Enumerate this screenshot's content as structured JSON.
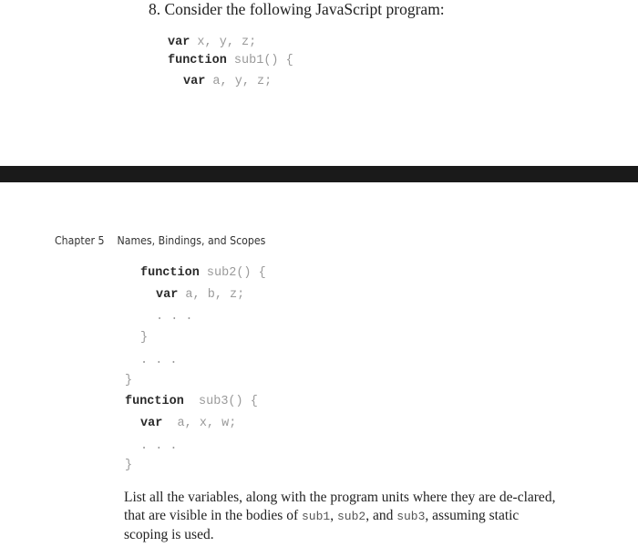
{
  "exercise": {
    "title": "8. Consider the following JavaScript program:"
  },
  "code_top": [
    {
      "kw": "var",
      "rest": " x, y, z;"
    },
    {
      "kw": "function",
      "rest": " sub1() {"
    },
    {
      "kw": "var",
      "rest": " a, y, z;"
    }
  ],
  "separator_color": "#1a1a1a",
  "running_head": {
    "chapter": "Chapter 5",
    "title": "Names, Bindings, and Scopes"
  },
  "code_bottom": [
    {
      "kw": "function",
      "rest": " sub2() {"
    },
    {
      "kw": "var",
      "rest": " a, b, z;"
    },
    {
      "kw": "",
      "rest": ". . ."
    },
    {
      "kw": "",
      "rest": "}"
    },
    {
      "kw": "",
      "rest": ". . ."
    },
    {
      "kw": "",
      "rest": "}"
    },
    {
      "kw": "function",
      "rest": "  sub3() {"
    },
    {
      "kw": "var",
      "rest": "  a, x, w;"
    },
    {
      "kw": "",
      "rest": ". . ."
    },
    {
      "kw": "",
      "rest": "}"
    }
  ],
  "question": {
    "p1": "List all the variables, along with the program units where they are de-clared, that are visible in the bodies of ",
    "c1": "sub1",
    "p2": ", ",
    "c2": "sub2",
    "p3": ", and ",
    "c3": "sub3",
    "p4": ", assuming static scoping is used."
  }
}
